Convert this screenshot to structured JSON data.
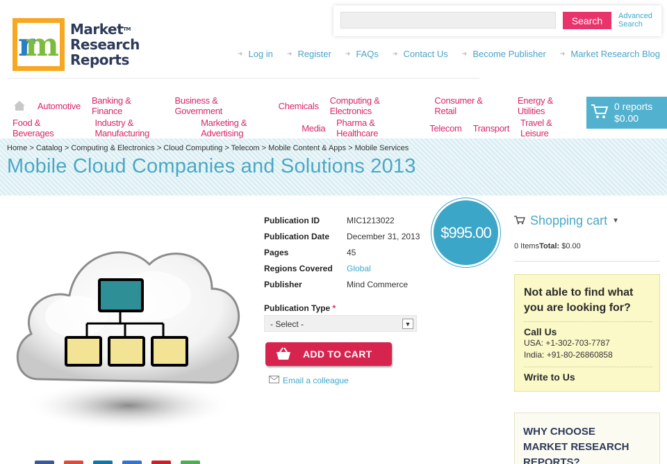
{
  "logo": {
    "line1": "Market",
    "line2": "Research",
    "line3": "Reports",
    "tm": "TM"
  },
  "search": {
    "placeholder": "",
    "button": "Search",
    "advanced_line1": "Advanced",
    "advanced_line2": "Search"
  },
  "top_links": [
    "Log in",
    "Register",
    "FAQs",
    "Contact Us",
    "Become Publisher",
    "Market Research Blog"
  ],
  "categories_row1": [
    "Automotive",
    "Banking & Finance",
    "Business & Government",
    "Chemicals",
    "Computing & Electronics",
    "Consumer & Retail",
    "Energy & Utilities"
  ],
  "categories_row2": [
    "Food & Beverages",
    "Industry & Manufacturing",
    "Marketing & Advertising",
    "Media",
    "Pharma & Healthcare",
    "Telecom",
    "Transport",
    "Travel & Leisure"
  ],
  "cart": {
    "reports": "0 reports",
    "total": "$0.00"
  },
  "breadcrumb": "Home > Catalog > Computing & Electronics > Cloud Computing > Telecom > Mobile Content & Apps > Mobile Services",
  "page_title": "Mobile Cloud Companies and Solutions 2013",
  "specs": [
    {
      "label": "Publication ID",
      "value": "MIC1213022"
    },
    {
      "label": "Publication Date",
      "value": "December 31, 2013"
    },
    {
      "label": "Pages",
      "value": "45"
    },
    {
      "label": "Regions Covered",
      "value": "Global"
    },
    {
      "label": "Publisher",
      "value": "Mind Commerce"
    }
  ],
  "price": "$995.00",
  "publication_type": {
    "label": "Publication Type",
    "required": "*",
    "selected": "- Select -"
  },
  "add_to_cart": "ADD TO CART",
  "email_colleague": "Email a colleague",
  "shopping_cart": {
    "title": "Shopping cart",
    "items": "0 Items",
    "total_label": "Total:",
    "total": "$0.00"
  },
  "help": {
    "question": "Not able to find what you are looking for?",
    "call_title": "Call Us",
    "usa": "USA: +1-302-703-7787",
    "india": "India: +91-80-26860858",
    "write_title": "Write to Us"
  },
  "why": {
    "line1": "WHY CHOOSE",
    "line2": "MARKET RESEARCH",
    "line3": "REPORTS?"
  },
  "colors": {
    "accent_blue": "#3ba6c8",
    "accent_pink": "#d8266a",
    "cart_red": "#d7244f",
    "help_yellow": "#fbf9c8"
  }
}
